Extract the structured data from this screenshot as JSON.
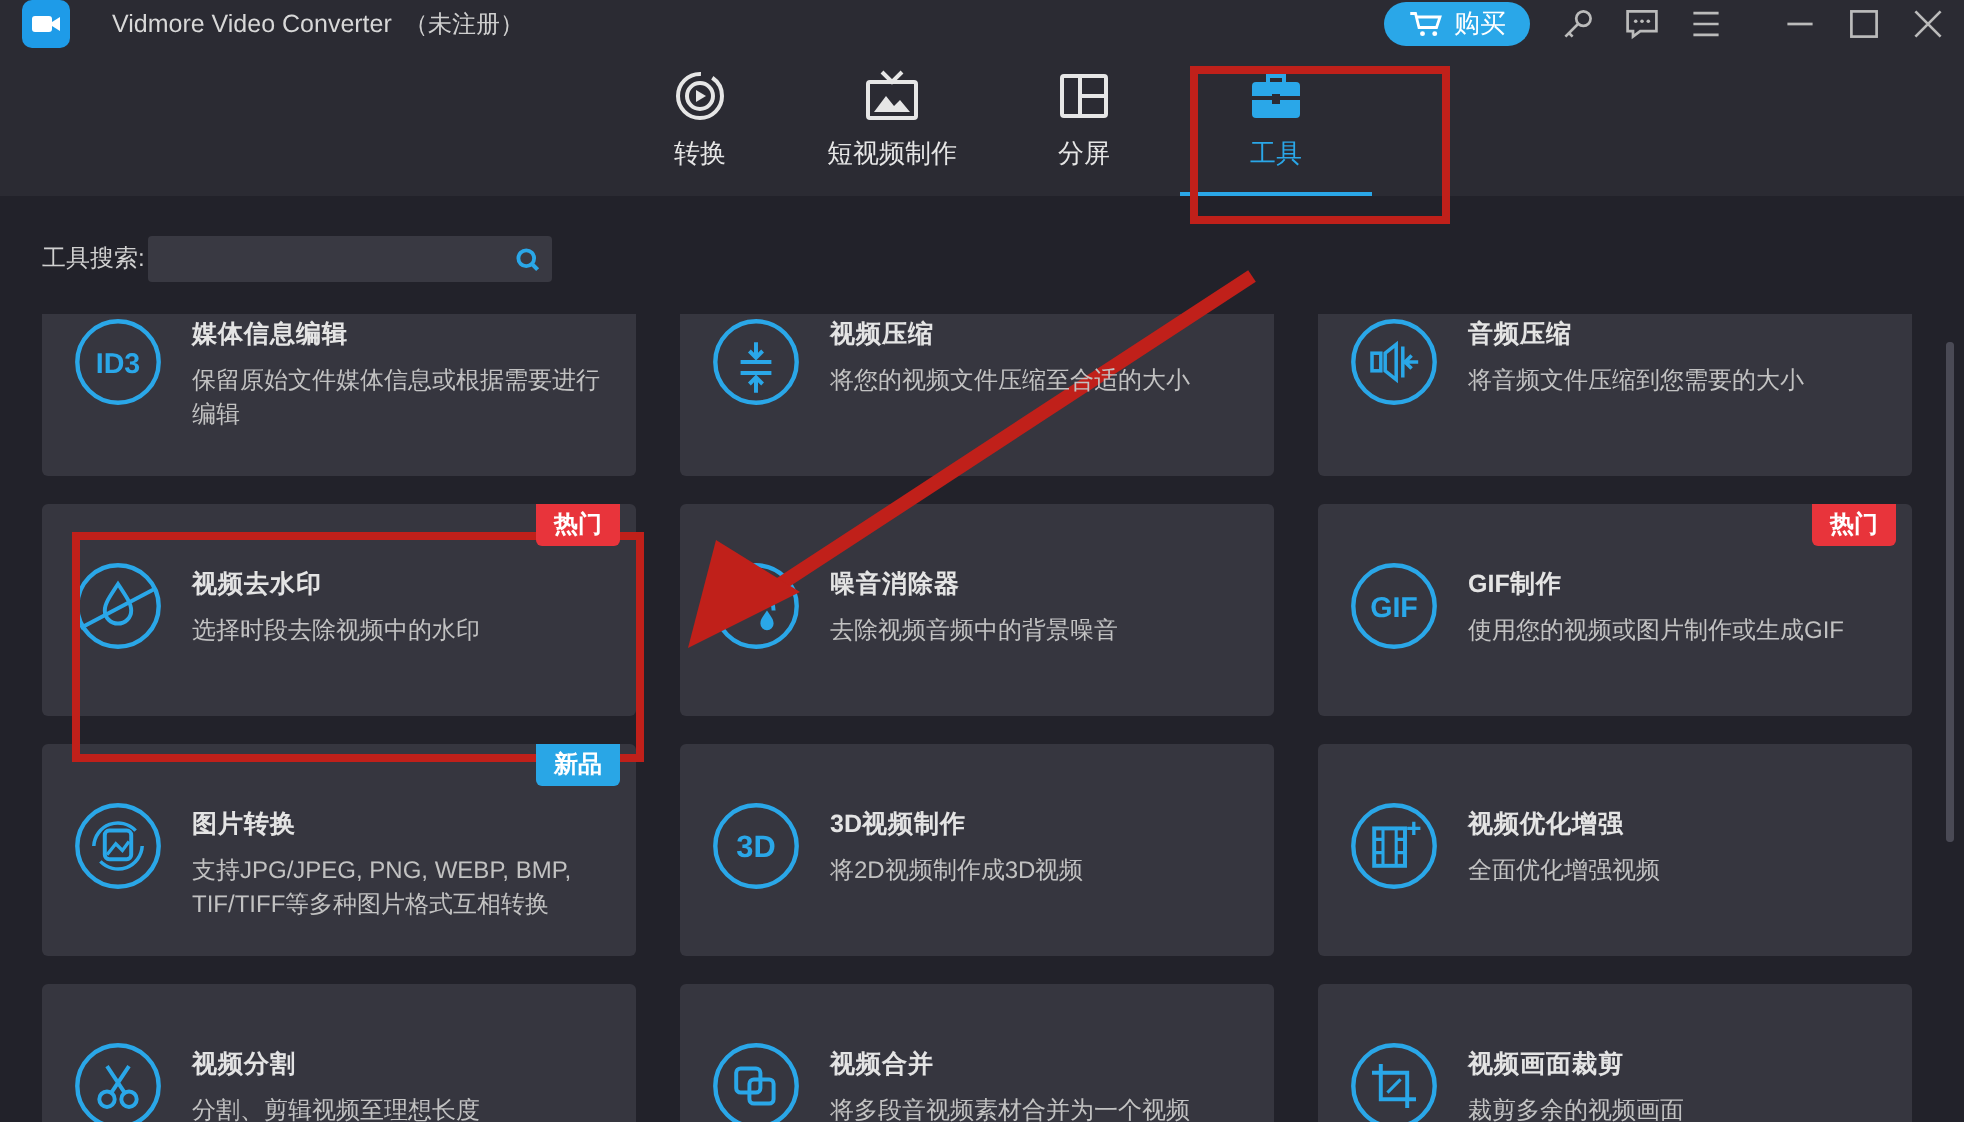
{
  "window": {
    "title": "Vidmore Video Converter",
    "status": "（未注册）",
    "buy_button": "购买"
  },
  "tabs": [
    {
      "label": "转换",
      "selected": false
    },
    {
      "label": "短视频制作",
      "selected": false
    },
    {
      "label": "分屏",
      "selected": false
    },
    {
      "label": "工具",
      "selected": true
    }
  ],
  "search": {
    "label": "工具搜索:"
  },
  "tools": [
    {
      "title": "媒体信息编辑",
      "description": "保留原始文件媒体信息或根据需要进行编辑",
      "icon_label": "ID3"
    },
    {
      "title": "视频压缩",
      "description": "将您的视频文件压缩至合适的大小"
    },
    {
      "title": "音频压缩",
      "description": "将音频文件压缩到您需要的大小"
    },
    {
      "title": "视频去水印",
      "description": "选择时段去除视频中的水印",
      "badge": {
        "text": "热门",
        "kind": "hot"
      }
    },
    {
      "title": "噪音消除器",
      "description": "去除视频音频中的背景噪音"
    },
    {
      "title": "GIF制作",
      "description": "使用您的视频或图片制作或生成GIF",
      "icon_label": "GIF",
      "badge": {
        "text": "热门",
        "kind": "hot"
      }
    },
    {
      "title": "图片转换",
      "description": "支持JPG/JPEG, PNG, WEBP, BMP, TIF/TIFF等多种图片格式互相转换",
      "badge": {
        "text": "新品",
        "kind": "new"
      }
    },
    {
      "title": "3D视频制作",
      "description": "将2D视频制作成3D视频",
      "icon_label": "3D"
    },
    {
      "title": "视频优化增强",
      "description": "全面优化增强视频"
    },
    {
      "title": "视频分割",
      "description": "分割、剪辑视频至理想长度"
    },
    {
      "title": "视频合并",
      "description": "将多段音视频素材合并为一个视频"
    },
    {
      "title": "视频画面裁剪",
      "description": "裁剪多余的视频画面"
    }
  ],
  "annotations": [
    {
      "kind": "box"
    },
    {
      "kind": "box"
    },
    {
      "kind": "arrow"
    }
  ]
}
